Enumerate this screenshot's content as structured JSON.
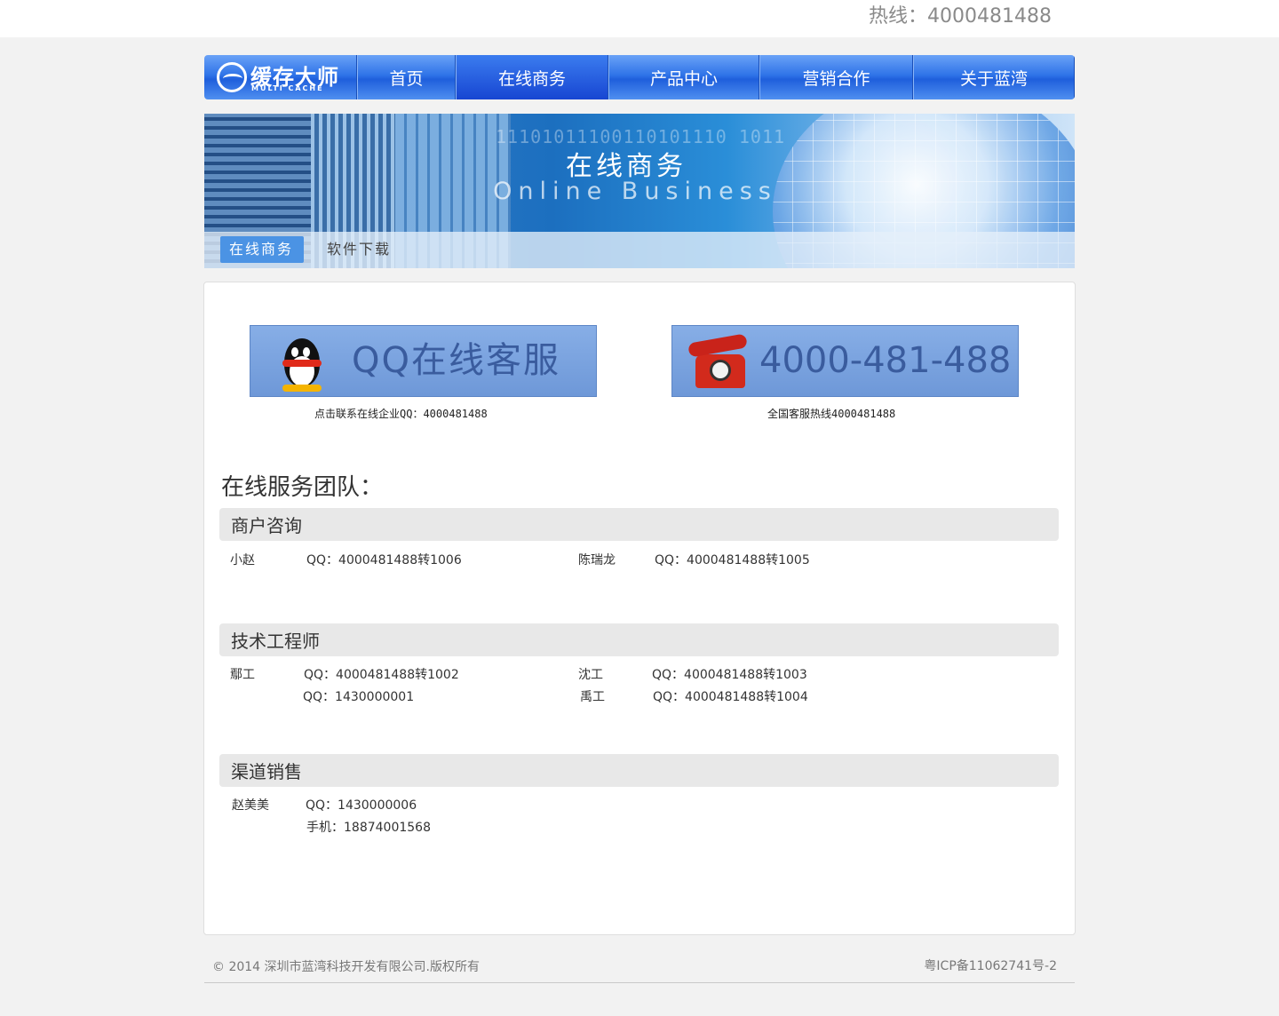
{
  "topbar": {
    "hotline": "热线：4000481488"
  },
  "nav": {
    "logo_text": "缓存大师",
    "logo_sub": "MULTI CACHE",
    "items": [
      "首页",
      "在线商务",
      "产品中心",
      "营销合作",
      "关于蓝湾"
    ],
    "active_index": 1
  },
  "banner": {
    "title": "在线商务",
    "subtitle": "Online Business",
    "digits": "11101011100110101110 1011",
    "subnav": [
      "在线商务",
      "软件下载"
    ]
  },
  "contact": {
    "qq_button": "QQ在线客服",
    "qq_caption": "点击联系在线企业QQ：4000481488",
    "tel_button": "4000-481-488",
    "tel_caption": "全国客服热线4000481488"
  },
  "team": {
    "title": "在线服务团队：",
    "sections": [
      {
        "name": "商户咨询",
        "members": [
          {
            "name": "小赵",
            "lines": [
              "QQ：4000481488转1006"
            ]
          },
          {
            "name": "陈瑞龙",
            "lines": [
              "QQ：4000481488转1005"
            ]
          }
        ]
      },
      {
        "name": "技术工程师",
        "members": [
          {
            "name": "鄢工",
            "lines": [
              "QQ：4000481488转1002",
              "QQ：1430000001"
            ]
          },
          {
            "name": "沈工",
            "lines": [
              "QQ：4000481488转1003"
            ]
          },
          {
            "name": "禹工",
            "lines": [
              "QQ：4000481488转1004"
            ]
          }
        ]
      },
      {
        "name": "渠道销售",
        "members": [
          {
            "name": "赵美美",
            "lines": [
              "QQ：1430000006",
              "手机：18874001568"
            ]
          }
        ]
      }
    ]
  },
  "footer": {
    "copyright": "© 2014 深圳市蓝湾科技开发有限公司.版权所有",
    "icp": "粤ICP备11062741号-2"
  },
  "colors": {
    "nav_blue": "#2f74e8",
    "active_tab": "#4b93e4",
    "section_bg": "#e8e8e8"
  }
}
